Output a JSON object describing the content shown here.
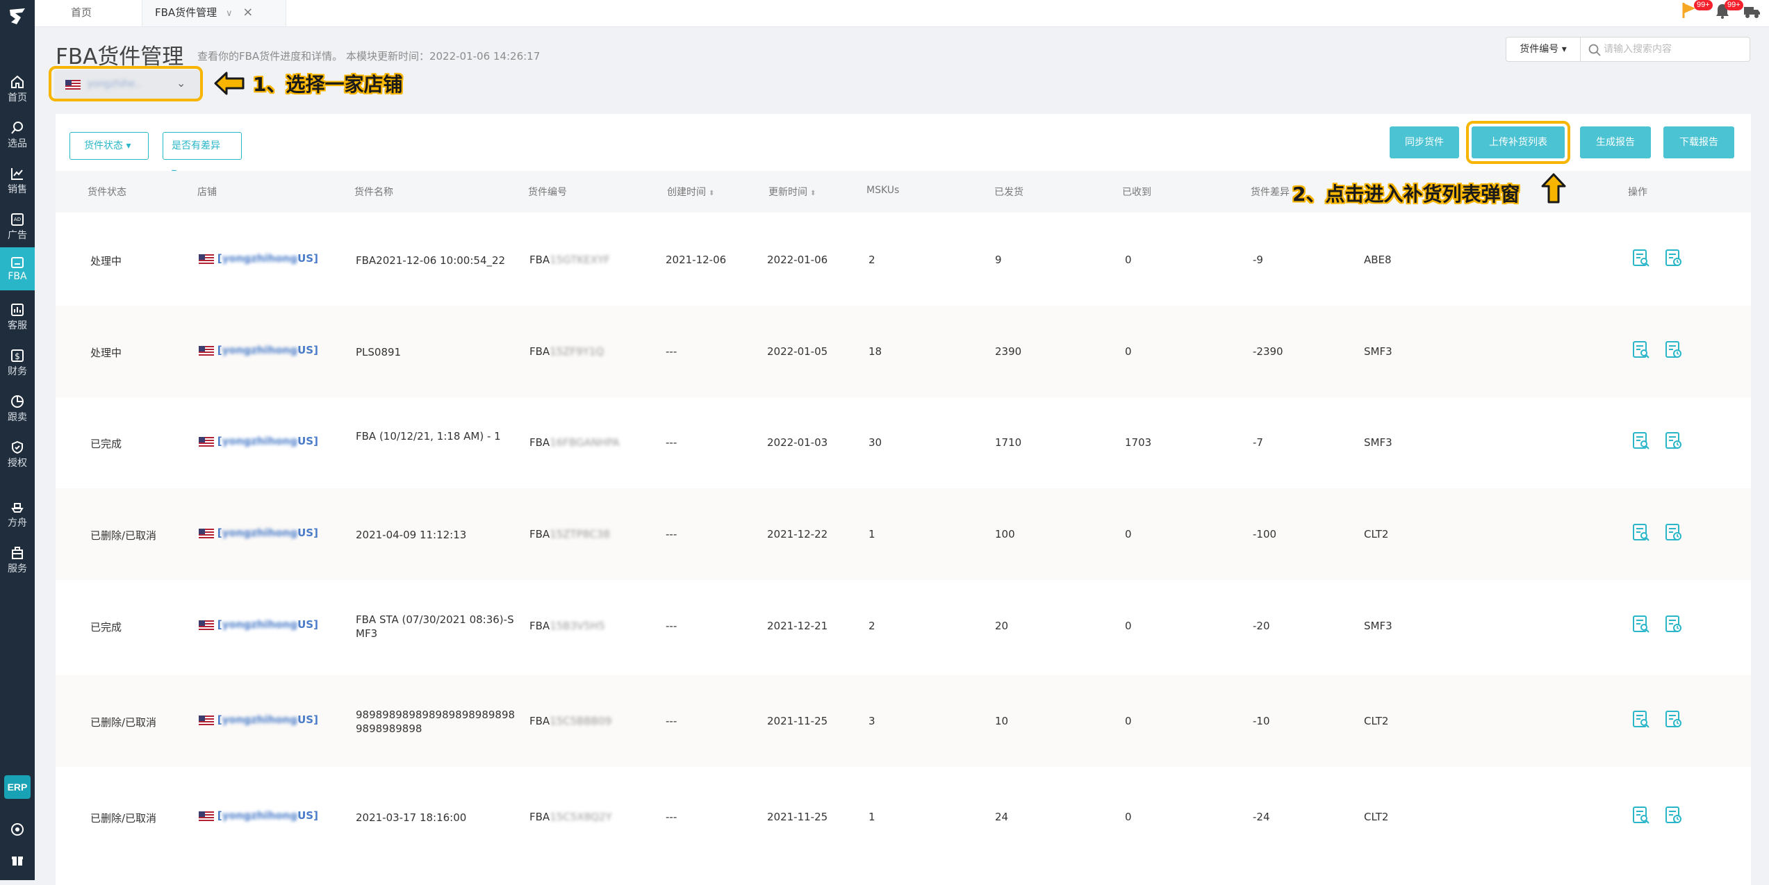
{
  "tabs": {
    "home": "首页",
    "fba": "FBA货件管理"
  },
  "top_badges": [
    "99+",
    "99+"
  ],
  "sidebar": {
    "items": [
      {
        "label": "首页",
        "icon": "home-icon"
      },
      {
        "label": "选品",
        "icon": "search-icon"
      },
      {
        "label": "销售",
        "icon": "chart-icon"
      },
      {
        "label": "广告",
        "icon": "ad-icon"
      },
      {
        "label": "FBA",
        "icon": "box-icon"
      },
      {
        "label": "客服",
        "icon": "service-icon"
      },
      {
        "label": "财务",
        "icon": "dollar-icon"
      },
      {
        "label": "跟卖",
        "icon": "pie-icon"
      },
      {
        "label": "授权",
        "icon": "shield-icon"
      },
      {
        "label": "方舟",
        "icon": "ship-icon"
      },
      {
        "label": "服务",
        "icon": "building-icon"
      }
    ],
    "erp": "ERP"
  },
  "header": {
    "title": "FBA货件管理",
    "desc": "查看你的FBA货件进度和详情。 本模块更新时间：2022-01-06 14:26:17",
    "store_select": "yongzhihe..",
    "annot1": "1、选择一家店铺",
    "annot2": "2、点击进入补货列表弹窗"
  },
  "search": {
    "category": "货件编号 ▾",
    "placeholder": "请输入搜索内容"
  },
  "filters": {
    "status": "货件状态 ▾",
    "diff": "是否有差异 ▾"
  },
  "actions": {
    "sync": "同步货件",
    "upload": "上传补货列表",
    "gen_report": "生成报告",
    "download_report": "下载报告"
  },
  "columns": {
    "status": "货件状态",
    "store": "店铺",
    "name": "货件名称",
    "code": "货件编号",
    "created": "创建时间",
    "updated": "更新时间",
    "mskus": "MSKUs",
    "sent": "已发货",
    "received": "已收到",
    "diff": "货件差异",
    "warehouse": "",
    "ops": "操作"
  },
  "rows": [
    {
      "status": "处理中",
      "store_pre": "[",
      "store_blur": "yongzhihong",
      "store_suffix": "US]",
      "name": "FBA2021-12-06 10:00:54_22",
      "code_pre": "FBA",
      "code_blur": "15GTKEXYF",
      "created": "2021-12-06",
      "updated": "2022-01-06",
      "mskus": "2",
      "sent": "9",
      "received": "0",
      "diff": "-9",
      "wh": "ABE8"
    },
    {
      "status": "处理中",
      "store_pre": "[",
      "store_blur": "yongzhihong",
      "store_suffix": "US]",
      "name": "PLS0891",
      "code_pre": "FBA",
      "code_blur": "15ZF9Y1Q",
      "created": "---",
      "updated": "2022-01-05",
      "mskus": "18",
      "sent": "2390",
      "received": "0",
      "diff": "-2390",
      "wh": "SMF3"
    },
    {
      "status": "已完成",
      "store_pre": "[",
      "store_blur": "yongzhihong",
      "store_suffix": "US]",
      "name": "FBA (10/12/21, 1:18 AM) - 1",
      "code_pre": "FBA",
      "code_blur": "16FBGANHPA",
      "created": "---",
      "updated": "2022-01-03",
      "mskus": "30",
      "sent": "1710",
      "received": "1703",
      "diff": "-7",
      "wh": "SMF3"
    },
    {
      "status": "已删除/已取消",
      "store_pre": "[",
      "store_blur": "yongzhihong",
      "store_suffix": "US]",
      "name": "2021-04-09 11:12:13",
      "code_pre": "FBA",
      "code_blur": "15ZTP8C38",
      "created": "---",
      "updated": "2021-12-22",
      "mskus": "1",
      "sent": "100",
      "received": "0",
      "diff": "-100",
      "wh": "CLT2"
    },
    {
      "status": "已完成",
      "store_pre": "[",
      "store_blur": "yongzhihong",
      "store_suffix": "US]",
      "name": "FBA STA (07/30/2021 08:36)-SMF3",
      "code_pre": "FBA",
      "code_blur": "15B3V5H5",
      "created": "---",
      "updated": "2021-12-21",
      "mskus": "2",
      "sent": "20",
      "received": "0",
      "diff": "-20",
      "wh": "SMF3"
    },
    {
      "status": "已删除/已取消",
      "store_pre": "[",
      "store_blur": "yongzhihong",
      "store_suffix": "US]",
      "name": "9898989898989898989898989898989898",
      "code_pre": "FBA",
      "code_blur": "15C5BBB09",
      "created": "---",
      "updated": "2021-11-25",
      "mskus": "3",
      "sent": "10",
      "received": "0",
      "diff": "-10",
      "wh": "CLT2"
    },
    {
      "status": "已删除/已取消",
      "store_pre": "[",
      "store_blur": "yongzhihong",
      "store_suffix": "US]",
      "name": "2021-03-17 18:16:00",
      "code_pre": "FBA",
      "code_blur": "15C5X8Q2Y",
      "created": "---",
      "updated": "2021-11-25",
      "mskus": "1",
      "sent": "24",
      "received": "0",
      "diff": "-24",
      "wh": "CLT2"
    }
  ],
  "colors": {
    "accent": "#29b6c8",
    "sidebar": "#1f2d3d",
    "highlight": "#f7b500"
  }
}
